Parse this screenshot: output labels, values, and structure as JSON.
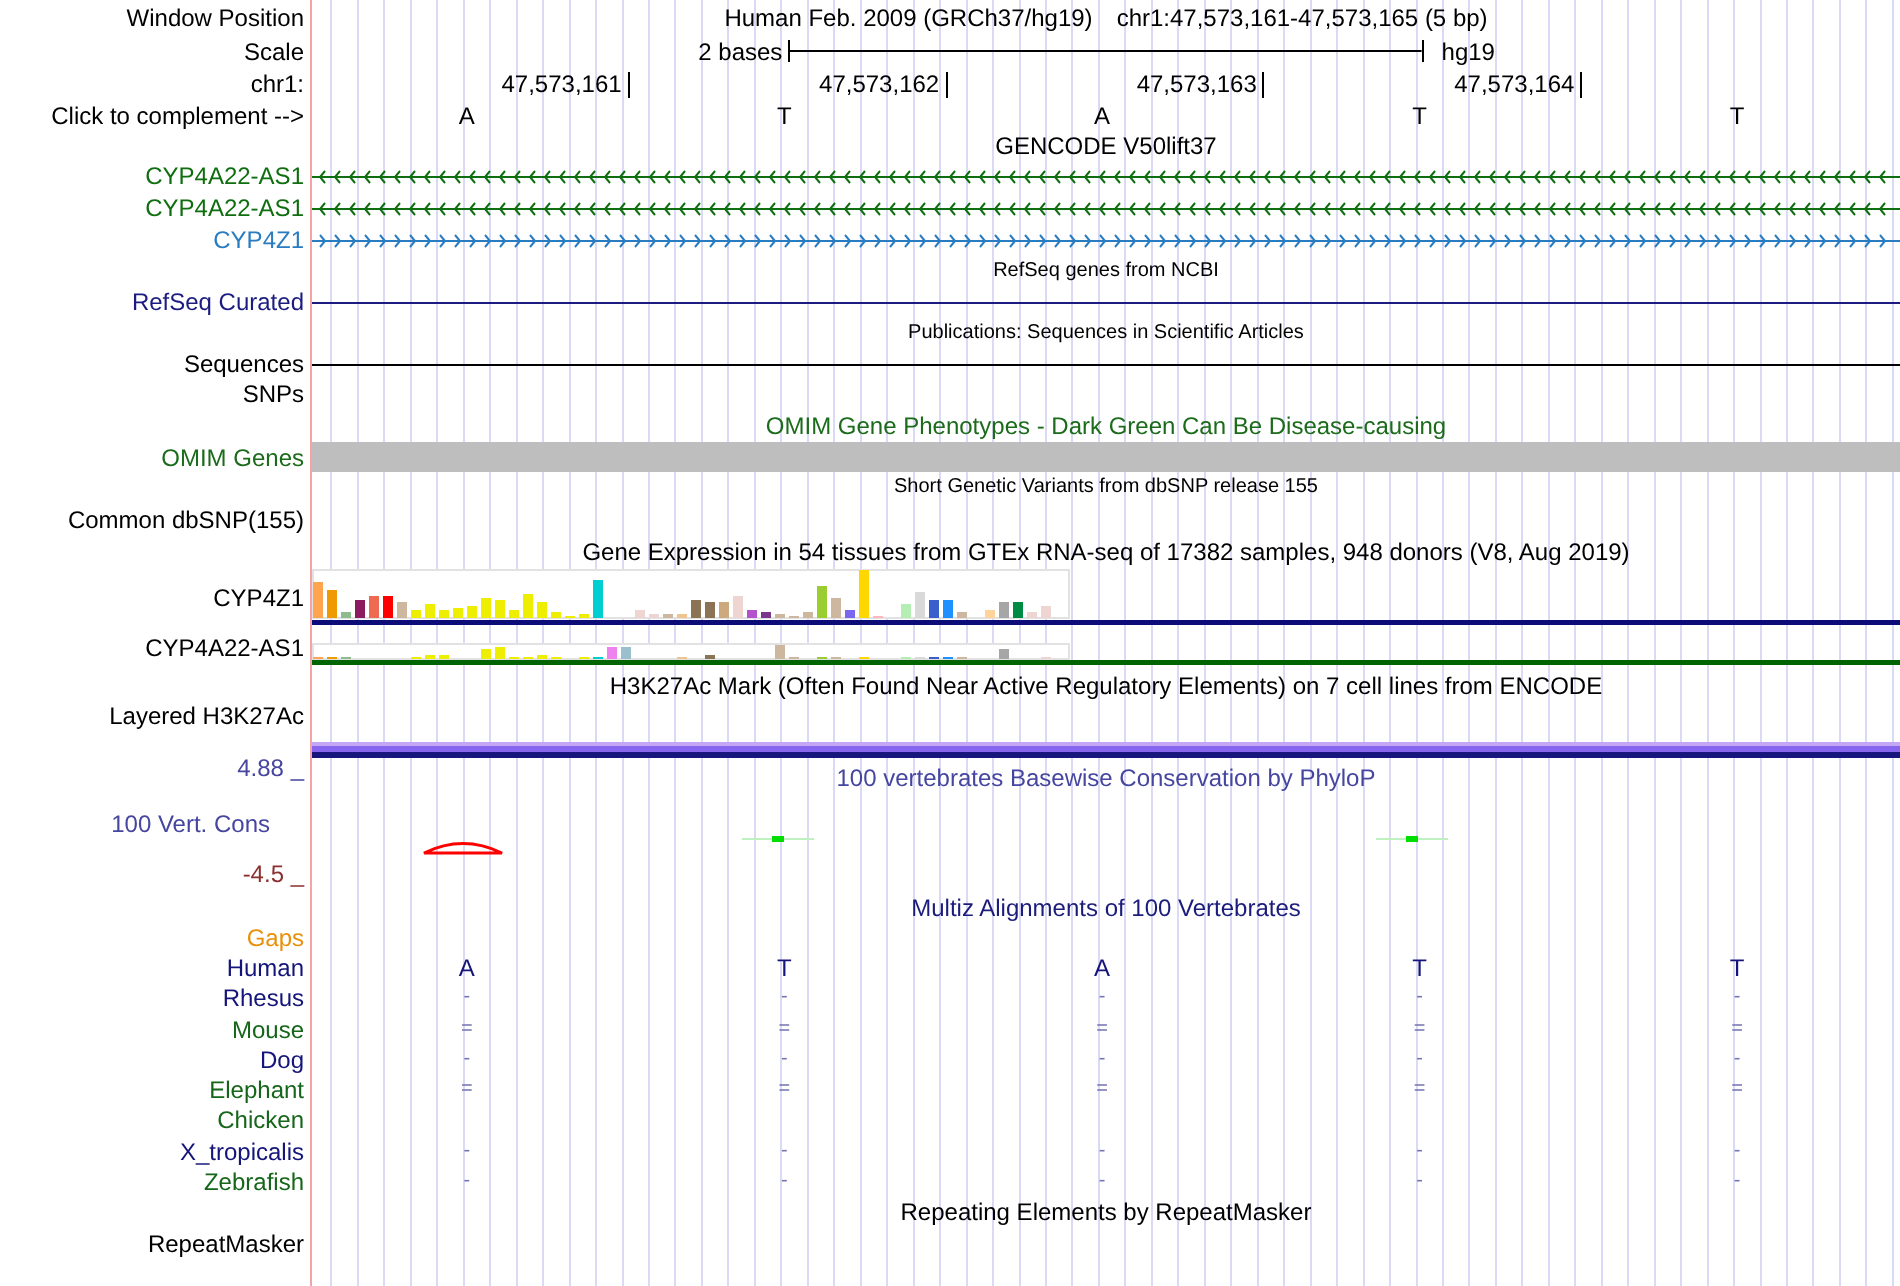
{
  "position": {
    "label": "Window Position",
    "assembly": "Human Feb. 2009 (GRCh37/hg19)",
    "range": "chr1:47,573,161-47,573,165 (5 bp)"
  },
  "scale": {
    "label": "Scale",
    "span": "2 bases",
    "assembly": "hg19"
  },
  "ruler": {
    "label": "chr1:",
    "ticks": [
      "47,573,161",
      "47,573,162",
      "47,573,163",
      "47,573,164"
    ]
  },
  "sequence": {
    "label": "Click to complement -->",
    "bases": [
      "A",
      "T",
      "A",
      "T",
      "T"
    ]
  },
  "tracks": [
    {
      "kind": "gencode",
      "title": "GENCODE V50lift37",
      "rows": [
        {
          "kind": "gene",
          "label": "CYP4A22-AS1",
          "reverse": true,
          "color": "#0f6e0f"
        },
        {
          "kind": "gene",
          "label": "CYP4A22-AS1",
          "reverse": true,
          "color": "#0f6e0f"
        },
        {
          "kind": "gene",
          "label": "CYP4Z1",
          "reverse": false,
          "color": "#2a7cc0"
        }
      ]
    },
    {
      "kind": "refseq",
      "title": "RefSeq genes from NCBI",
      "rows": [
        {
          "kind": "line",
          "label": "RefSeq Curated"
        }
      ]
    },
    {
      "kind": "publications",
      "title": "Publications: Sequences in Scientific Articles",
      "rows": [
        {
          "kind": "line",
          "label": "Sequences"
        },
        {
          "kind": "empty",
          "label": "SNPs"
        }
      ]
    },
    {
      "kind": "omim",
      "title": "OMIM Gene Phenotypes - Dark Green Can Be Disease-causing",
      "rows": [
        {
          "kind": "block",
          "label": "OMIM Genes"
        }
      ]
    },
    {
      "kind": "dbsnp",
      "title": "Short Genetic Variants from dbSNP release 155",
      "rows": [
        {
          "kind": "empty",
          "label": "Common dbSNP(155)"
        }
      ]
    },
    {
      "kind": "gtex",
      "title": "Gene Expression in 54 tissues from GTEx RNA-seq of 17382 samples, 948 donors (V8, Aug 2019)",
      "rows": [
        {
          "kind": "expression",
          "label": "CYP4Z1",
          "color": "#0c0c78"
        },
        {
          "kind": "expression",
          "label": "CYP4A22-AS1",
          "color": "#006400"
        }
      ]
    },
    {
      "kind": "h3k27ac",
      "title": "H3K27Ac Mark (Often Found Near Active Regulatory Elements) on 7 cell lines from ENCODE",
      "rows": [
        {
          "kind": "band",
          "label": "Layered H3K27Ac"
        }
      ]
    },
    {
      "kind": "phylop",
      "title": "100 vertebrates Basewise Conservation by PhyloP",
      "rows": [
        {
          "kind": "wiggle",
          "label": "100 Vert. Cons",
          "max": "4.88 _",
          "min": "-4.5 _"
        }
      ]
    },
    {
      "kind": "multiz",
      "title": "Multiz Alignments of 100 Vertebrates",
      "rows": [
        {
          "kind": "species",
          "label": "Gaps",
          "color": "#e8900c"
        },
        {
          "kind": "reference",
          "label": "Human",
          "color": "#14147a",
          "cells": [
            "A",
            "T",
            "A",
            "T",
            "T"
          ]
        },
        {
          "kind": "species",
          "label": "Rhesus",
          "color": "#14147a",
          "cells": [
            "-",
            "-",
            "-",
            "-",
            "-"
          ]
        },
        {
          "kind": "species",
          "label": "Mouse",
          "color": "#16661a",
          "cells": [
            "=",
            "=",
            "=",
            "=",
            "="
          ]
        },
        {
          "kind": "species",
          "label": "Dog",
          "color": "#14147a",
          "cells": [
            "-",
            "-",
            "-",
            "-",
            "-"
          ]
        },
        {
          "kind": "species",
          "label": "Elephant",
          "color": "#16661a",
          "cells": [
            "=",
            "=",
            "=",
            "=",
            "="
          ]
        },
        {
          "kind": "species",
          "label": "Chicken",
          "color": "#16661a"
        },
        {
          "kind": "species",
          "label": "X_tropicalis",
          "color": "#14147a",
          "cells": [
            "-",
            "-",
            "-",
            "-",
            "-"
          ]
        },
        {
          "kind": "species",
          "label": "Zebrafish",
          "color": "#16661a",
          "cells": [
            "-",
            "-",
            "-",
            "-",
            "-"
          ]
        }
      ]
    },
    {
      "kind": "rmsk",
      "title": "Repeating Elements by RepeatMasker",
      "rows": [
        {
          "kind": "empty",
          "label": "RepeatMasker"
        }
      ]
    }
  ]
}
